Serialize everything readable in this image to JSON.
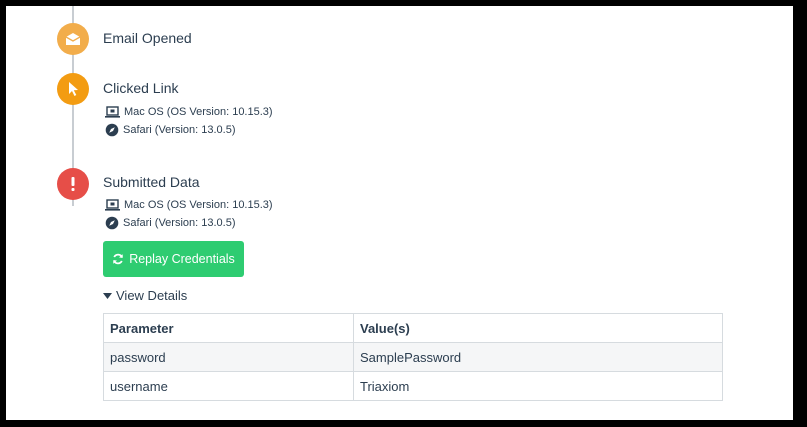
{
  "timeline": {
    "events": [
      {
        "title": "Email Opened",
        "icon": "envelope-open-icon",
        "color": "#f2ad4b"
      },
      {
        "title": "Clicked Link",
        "icon": "mouse-pointer-icon",
        "color": "#f39c12",
        "os": "Mac OS (OS Version: 10.15.3)",
        "browser": "Safari (Version: 13.0.5)"
      },
      {
        "title": "Submitted Data",
        "icon": "exclamation-icon",
        "color": "#e64e48",
        "os": "Mac OS (OS Version: 10.15.3)",
        "browser": "Safari (Version: 13.0.5)"
      }
    ]
  },
  "actions": {
    "replay_label": "Replay Credentials",
    "replay_color": "#2ecc71",
    "view_details_label": "View Details"
  },
  "details_table": {
    "headers": [
      "Parameter",
      "Value(s)"
    ],
    "rows": [
      [
        "password",
        "SamplePassword"
      ],
      [
        "username",
        "Triaxiom"
      ]
    ]
  }
}
